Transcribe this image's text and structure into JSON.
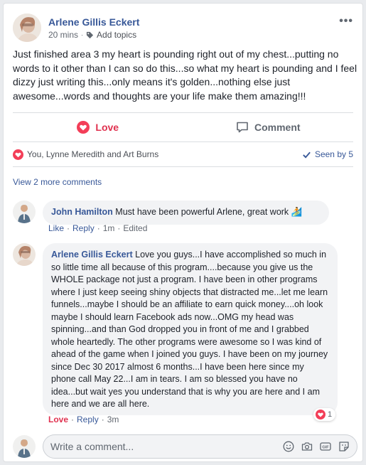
{
  "post": {
    "author": "Arlene Gillis Eckert",
    "time": "20 mins",
    "add_topics": "Add topics",
    "more": "•••",
    "text": "Just finished area 3 my heart is pounding right out of my chest...putting no words to it other than I can so do this...so what my heart is pounding and I feel dizzy just writing this...only means it's golden...nothing else just awesome...words and thoughts are your life make them amazing!!!"
  },
  "actions": {
    "love_label": "Love",
    "comment_label": "Comment"
  },
  "reactions": {
    "summary": "You, Lynne Meredith and Art Burns",
    "seen_by": "Seen by 5"
  },
  "view_more_comments": "View 2 more comments",
  "comments": [
    {
      "name": "John Hamilton",
      "text": "Must have been powerful Arlene, great work",
      "emoji": "🏄",
      "like": "Like",
      "reply": "Reply",
      "time": "1m",
      "edited": "Edited"
    },
    {
      "name": "Arlene Gillis Eckert",
      "text": "Love you guys...I have accomplished so much in so little time all because of this program....because you give us the WHOLE package not just a program. I have been in other programs where I just keep seeing shiny objects that distracted me...let me learn funnels...maybe I should be an affiliate to earn quick money....oh look maybe I should learn Facebook ads now...OMG my head was spinning...and than God dropped you in front of me and I grabbed whole heartedly. The other programs were awesome so I was kind of ahead of the game when I joined you guys. I have been on my journey since Dec 30 2017 almost 6 months...I have been here since my phone call May 22...I am in tears. I am so blessed you have no idea...but wait yes you understand that is why you are here and I am here and we are all here.",
      "love": "Love",
      "reply": "Reply",
      "time": "3m",
      "reaction_count": "1"
    }
  ],
  "composer": {
    "placeholder": "Write a comment..."
  },
  "colors": {
    "link": "#385898",
    "love": "#e0314f",
    "bubble": "#f2f3f5"
  }
}
